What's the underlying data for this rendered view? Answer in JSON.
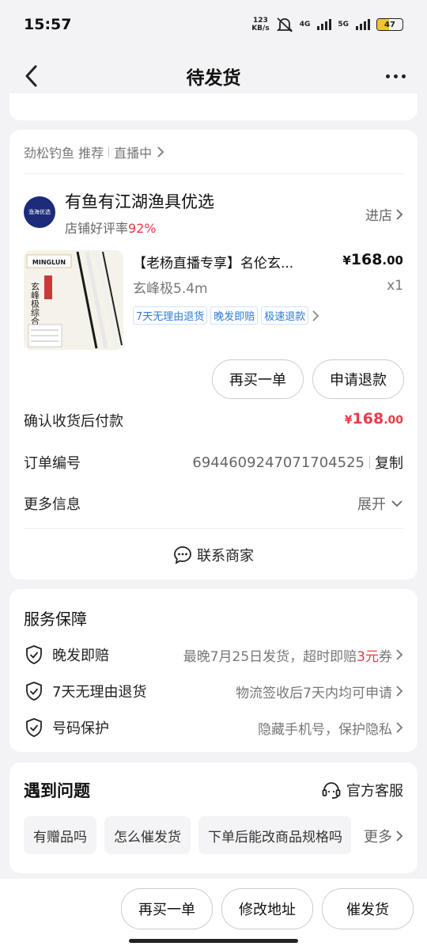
{
  "status_bar": {
    "time": "15:57",
    "net_speed_value": "123",
    "net_speed_unit": "KB/s",
    "signal1_label": "4G",
    "signal2_label": "5G",
    "battery": "47",
    "battery_level": 0.47,
    "battery_color": "#f2c230"
  },
  "nav": {
    "title": "待发货"
  },
  "order": {
    "live_source": "劲松钓鱼 推荐",
    "live_status": "直播中",
    "shop": {
      "logo_text": "渔海优选",
      "name": "有鱼有江湖渔具优选",
      "rating_label": "店铺好评率",
      "rating_value": "92%",
      "enter_label": "进店"
    },
    "product": {
      "title": "【老杨直播专享】名伦玄...",
      "price_symbol": "¥",
      "price_int": "168",
      "price_dec": ".00",
      "spec": "玄峰极5.4m",
      "qty": "x1",
      "tags": [
        "7天无理由退货",
        "晚发即赔",
        "极速退款"
      ],
      "img_brand": "MINGLUN",
      "img_text": "玄峰极综合竿"
    },
    "buttons": {
      "buy_again": "再买一单",
      "refund": "申请退款"
    },
    "payment": {
      "label": "确认收货后付款",
      "symbol": "¥",
      "amount_int": "168",
      "amount_dec": ".00"
    },
    "order_no": {
      "label": "订单编号",
      "value": "6944609247071704525",
      "copy": "复制"
    },
    "more_info": {
      "label": "更多信息",
      "expand": "展开"
    },
    "contact": "联系商家"
  },
  "service": {
    "title": "服务保障",
    "items": [
      {
        "name": "晚发即赔",
        "desc_prefix": "最晚7月25日发货，超时即赔",
        "desc_highlight": "3元",
        "desc_suffix": "券"
      },
      {
        "name": "7天无理由退货",
        "desc_prefix": "物流签收后7天内均可申请",
        "desc_highlight": "",
        "desc_suffix": ""
      },
      {
        "name": "号码保护",
        "desc_prefix": "隐藏手机号，保护隐私",
        "desc_highlight": "",
        "desc_suffix": ""
      }
    ]
  },
  "problems": {
    "title": "遇到问题",
    "official_service": "官方客服",
    "chips": [
      "有赠品吗",
      "怎么催发货",
      "下单后能改商品规格吗"
    ],
    "more": "更多"
  },
  "bottom_bar": {
    "buy_again": "再买一单",
    "change_address": "修改地址",
    "urge_shipping": "催发货"
  },
  "colors": {
    "accent_red": "#e83b4a",
    "tag_blue": "#2c7bd6"
  }
}
